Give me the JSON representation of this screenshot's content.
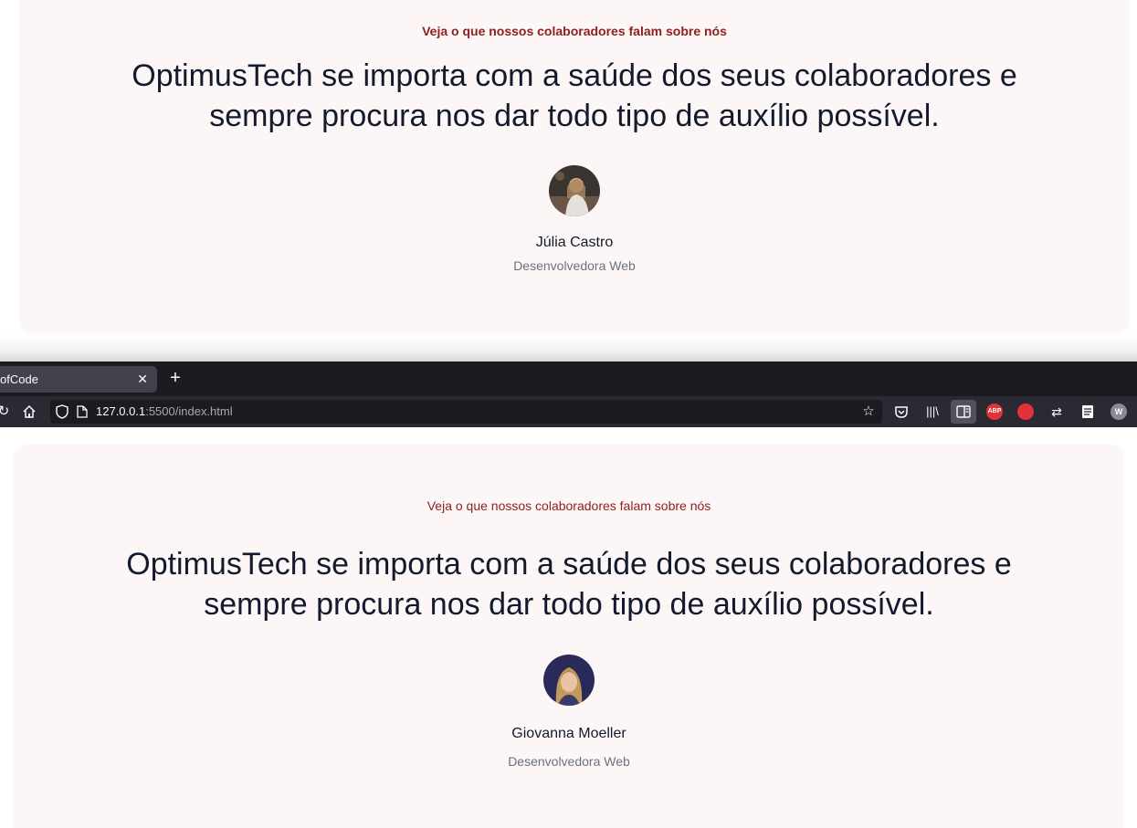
{
  "top_card": {
    "kicker": "Veja o que nossos colaboradores falam sobre nós",
    "quote_line1": "OptimusTech se importa com a saúde dos seus colaboradores e",
    "quote_line2": "sempre procura nos dar todo tipo de auxílio possível.",
    "name": "Júlia Castro",
    "role": "Desenvolvedora Web"
  },
  "browser": {
    "tab_title": "ofCode",
    "url_host": "127.0.0.1",
    "url_rest": ":5500/index.html",
    "extensions": {
      "abp_label": "ABP",
      "profile_label": "W"
    }
  },
  "bottom_card": {
    "kicker": "Veja o que nossos colaboradores falam sobre nós",
    "quote_line1": "OptimusTech se importa com a saúde dos seus colaboradores e",
    "quote_line2": "sempre procura nos dar todo tipo de auxílio possível.",
    "name": "Giovanna Moeller",
    "role": "Desenvolvedora Web"
  },
  "colors": {
    "card_background": "#fcf7f6",
    "kicker": "#8f2020",
    "heading": "#141a2e",
    "muted": "#6b7080",
    "browser_tabbar": "#1c1b22",
    "browser_navbar": "#2b2a33"
  }
}
